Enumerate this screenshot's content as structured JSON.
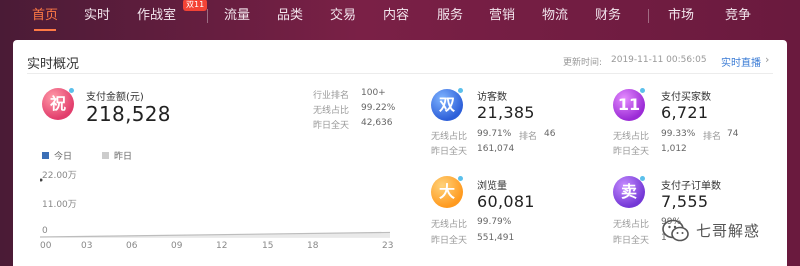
{
  "nav": {
    "items": [
      "首页",
      "实时",
      "作战室",
      "流量",
      "品类",
      "交易",
      "内容",
      "服务",
      "营销",
      "物流",
      "财务",
      "市场",
      "竞争"
    ],
    "active_index": 0,
    "badge": "双11",
    "colors": {
      "active": "#ff7a45",
      "text": "#f3e6ee",
      "bar_bg": "#6a1a3e"
    }
  },
  "panel": {
    "title": "实时概况",
    "update_label": "更新时间:",
    "update_time": "2019-11-11 00:56:05",
    "live_link": "实时直播",
    "live_arrow": "›"
  },
  "pay": {
    "icon_char": "祝",
    "label": "支付金额(元)",
    "value": "218,528",
    "rows": [
      {
        "label": "行业排名",
        "value": "100+"
      },
      {
        "label": "无线占比",
        "value": "99.22%"
      },
      {
        "label": "昨日全天",
        "value": "42,636"
      }
    ]
  },
  "visitors": {
    "icon_char": "双",
    "label": "访客数",
    "value": "21,385",
    "wireless_label": "无线占比",
    "wireless_value": "99.71%",
    "rank_label": "排名",
    "rank_value": "46",
    "yesterday_label": "昨日全天",
    "yesterday_value": "161,074"
  },
  "buyers": {
    "icon_char": "11",
    "label": "支付买家数",
    "value": "6,721",
    "wireless_value": "99.33%",
    "rank_label": "排名",
    "rank_value": "74",
    "yesterday_label": "昨日全天",
    "yesterday_value": "1,012"
  },
  "views": {
    "icon_char": "大",
    "label": "浏览量",
    "value": "60,081",
    "wireless_label": "无线占比",
    "wireless_value": "99.79%",
    "yesterday_label": "昨日全天",
    "yesterday_value": "551,491"
  },
  "orders": {
    "icon_char": "卖",
    "label": "支付子订单数",
    "value": "7,555",
    "wireless_label": "无线占比",
    "wireless_value": "99%",
    "yesterday_label": "昨日全天",
    "yesterday_value": "1"
  },
  "chart_data": {
    "type": "area",
    "series": [
      {
        "name": "今日",
        "color": "#3b6fb6"
      },
      {
        "name": "昨日",
        "color": "#cccccc"
      }
    ],
    "y_ticks": [
      "22.00万",
      "11.00万",
      "0"
    ],
    "x_ticks": [
      "00",
      "03",
      "06",
      "09",
      "12",
      "15",
      "18",
      "23"
    ],
    "ylim": [
      0,
      220000
    ],
    "x": [
      0,
      23
    ],
    "values": [
      0,
      15000
    ]
  },
  "watermark": {
    "text": "七哥解惑"
  }
}
